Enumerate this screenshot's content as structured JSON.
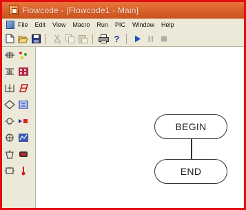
{
  "window": {
    "title": "Flowcode - [Flowcode1 - Main]"
  },
  "menu": {
    "items": [
      "File",
      "Edit",
      "View",
      "Macro",
      "Run",
      "PIC",
      "Window",
      "Help"
    ]
  },
  "toolbar": {
    "buttons": [
      {
        "icon": "new-file-icon"
      },
      {
        "icon": "open-folder-icon"
      },
      {
        "icon": "save-icon"
      },
      {
        "icon": "cut-icon",
        "enabled": false
      },
      {
        "icon": "copy-icon",
        "enabled": false
      },
      {
        "icon": "paste-icon",
        "enabled": false
      },
      {
        "icon": "print-icon"
      },
      {
        "icon": "help-icon"
      },
      {
        "icon": "run-icon"
      },
      {
        "icon": "pause-icon",
        "enabled": false
      },
      {
        "icon": "stop-icon",
        "enabled": false
      }
    ]
  },
  "palette": {
    "column1": [
      "input-icon",
      "output-icon",
      "delay-icon",
      "decision-icon",
      "connection-point-icon",
      "loop-icon",
      "macro-icon",
      "component-macro-icon"
    ],
    "column2": [
      "led-icon",
      "keypad-icon",
      "lcd-icon",
      "seven-segment-icon",
      "switch-icon",
      "adc-icon",
      "buzzer-icon",
      "thermometer-icon"
    ]
  },
  "flowchart": {
    "begin_label": "BEGIN",
    "end_label": "END"
  },
  "colors": {
    "titlebar": "#d8602a",
    "frame_border": "#e01010",
    "chrome": "#ece9d8"
  }
}
